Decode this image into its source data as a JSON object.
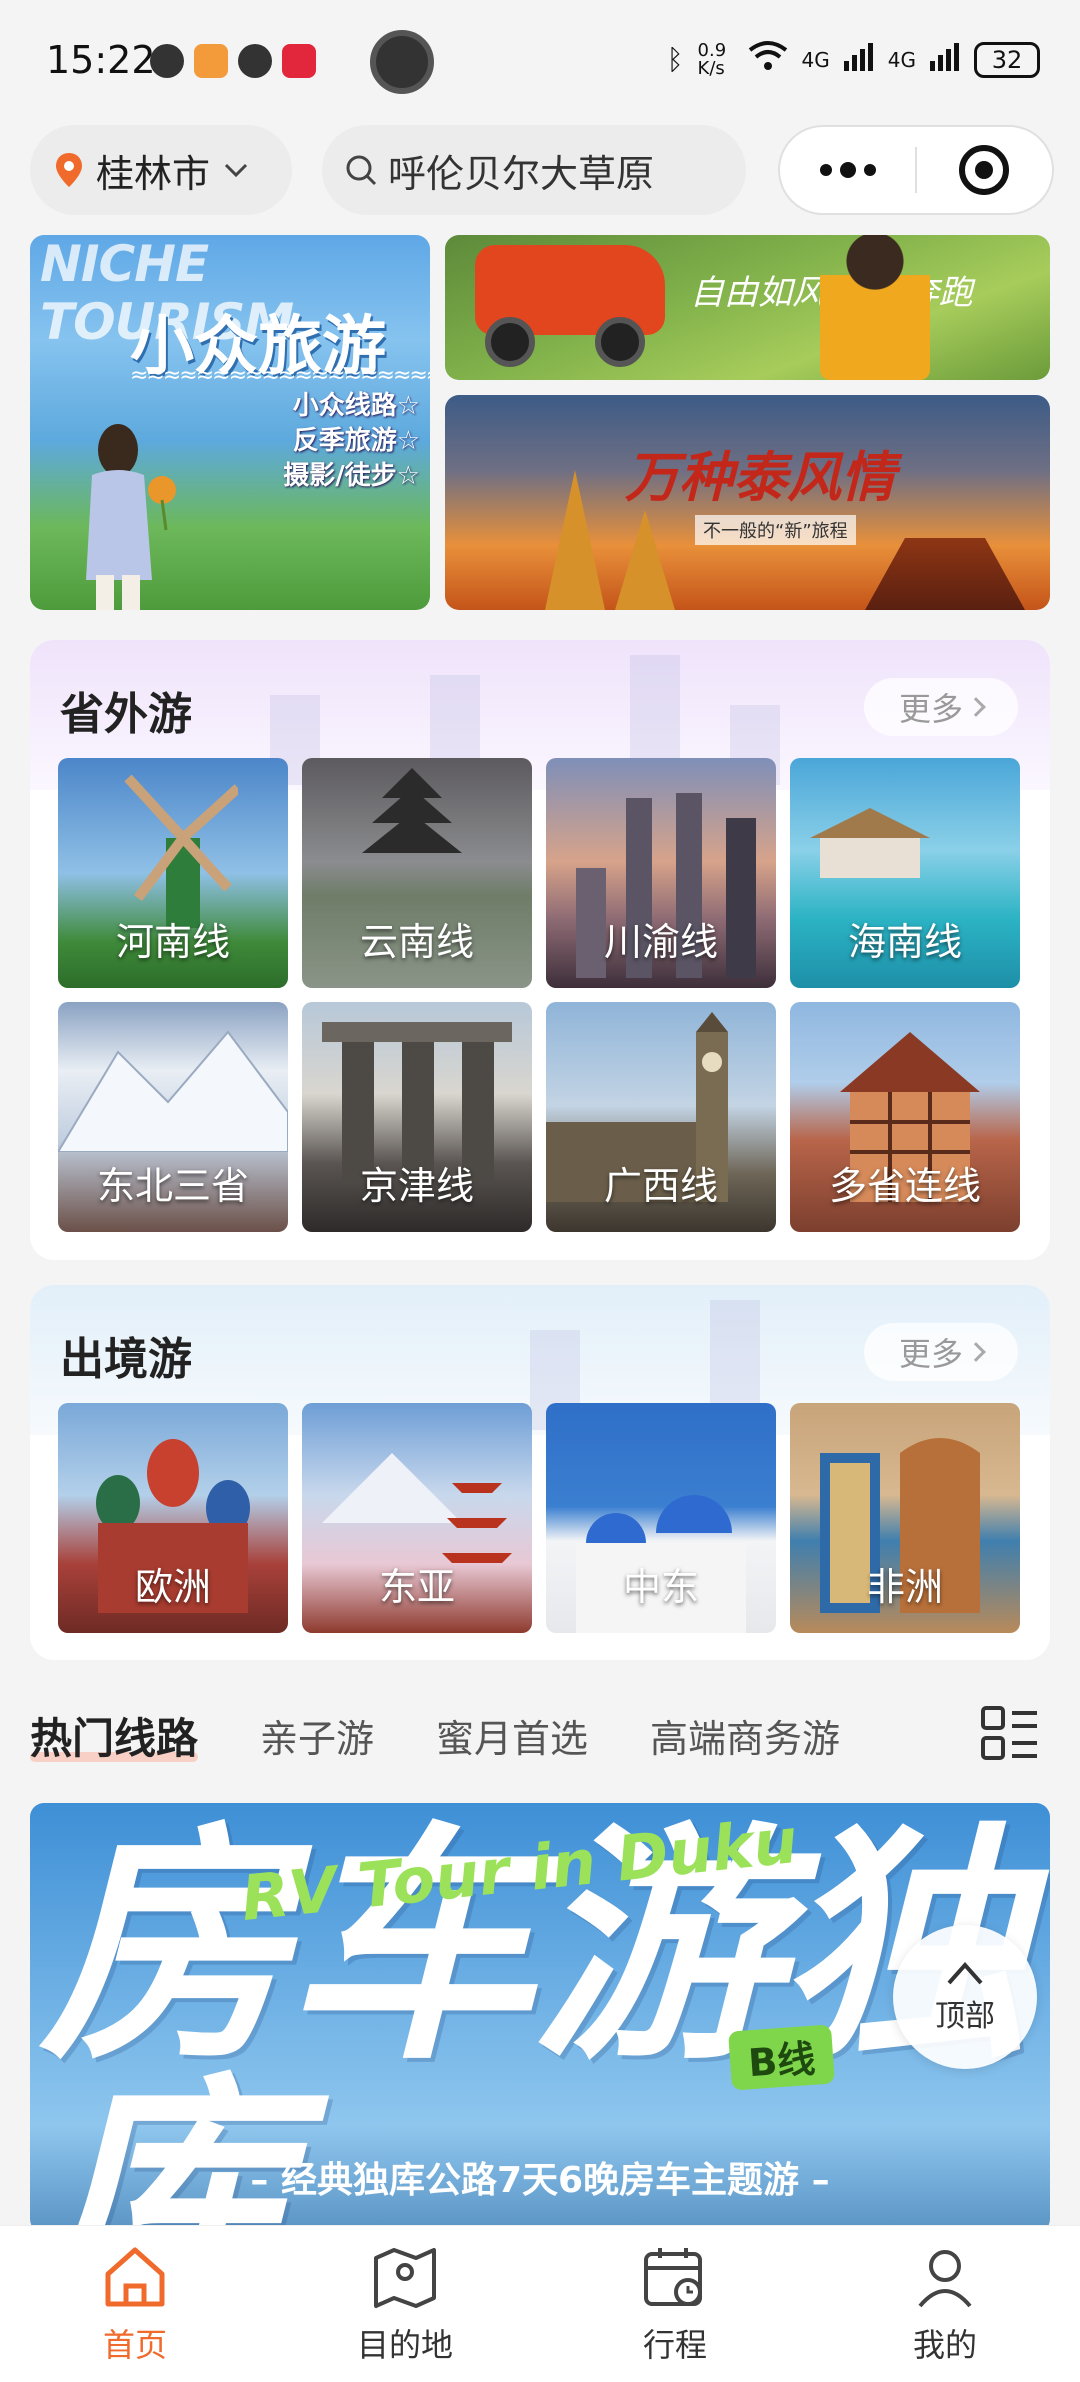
{
  "status": {
    "time": "15:22",
    "net_speed": "0.9 K/s",
    "signal1": "4G",
    "signal2": "4G",
    "battery": "32"
  },
  "header": {
    "city": "桂林市",
    "search_placeholder": "呼伦贝尔大草原"
  },
  "banners": {
    "left_eng": "NICHE TOURISM",
    "left_title": "小众旅游",
    "left_lines": [
      "小众线路☆",
      "反季旅游☆",
      "摄影/徒步☆"
    ],
    "top_right_script": "自由如风 尽情奔跑",
    "bottom_right_title": "万种泰风情",
    "bottom_right_sub": "不一般的“新”旅程"
  },
  "domestic": {
    "title": "省外游",
    "more": "更多",
    "tiles": [
      {
        "label": "河南线",
        "icon": "windmill-image"
      },
      {
        "label": "云南线",
        "icon": "pagoda-lake-image"
      },
      {
        "label": "川渝线",
        "icon": "city-towers-image"
      },
      {
        "label": "海南线",
        "icon": "beach-villa-image"
      },
      {
        "label": "东北三省",
        "icon": "snow-mountain-image"
      },
      {
        "label": "京津线",
        "icon": "marina-bay-image"
      },
      {
        "label": "广西线",
        "icon": "big-ben-image"
      },
      {
        "label": "多省连线",
        "icon": "timber-house-image"
      }
    ]
  },
  "abroad": {
    "title": "出境游",
    "more": "更多",
    "tiles": [
      {
        "label": "欧洲",
        "icon": "onion-domes-image"
      },
      {
        "label": "东亚",
        "icon": "fuji-pagoda-image"
      },
      {
        "label": "中东",
        "icon": "santorini-image"
      },
      {
        "label": "非洲",
        "icon": "tiled-plaza-image"
      }
    ]
  },
  "tabs": [
    "热门线路",
    "亲子游",
    "蜜月首选",
    "高端商务游"
  ],
  "rv_banner": {
    "title": "房车游独库",
    "script": "RV Tour in Duku",
    "badge": "B线",
    "footer": "– 经典独库公路7天6晚房车主题游 –"
  },
  "back_to_top": "顶部",
  "nav": [
    {
      "label": "首页",
      "active": true
    },
    {
      "label": "目的地",
      "active": false
    },
    {
      "label": "行程",
      "active": false
    },
    {
      "label": "我的",
      "active": false
    }
  ],
  "colors": {
    "accent": "#f06a2b",
    "domestic_wash": "#f2e8fb",
    "abroad_wash": "#e6f2fa"
  }
}
